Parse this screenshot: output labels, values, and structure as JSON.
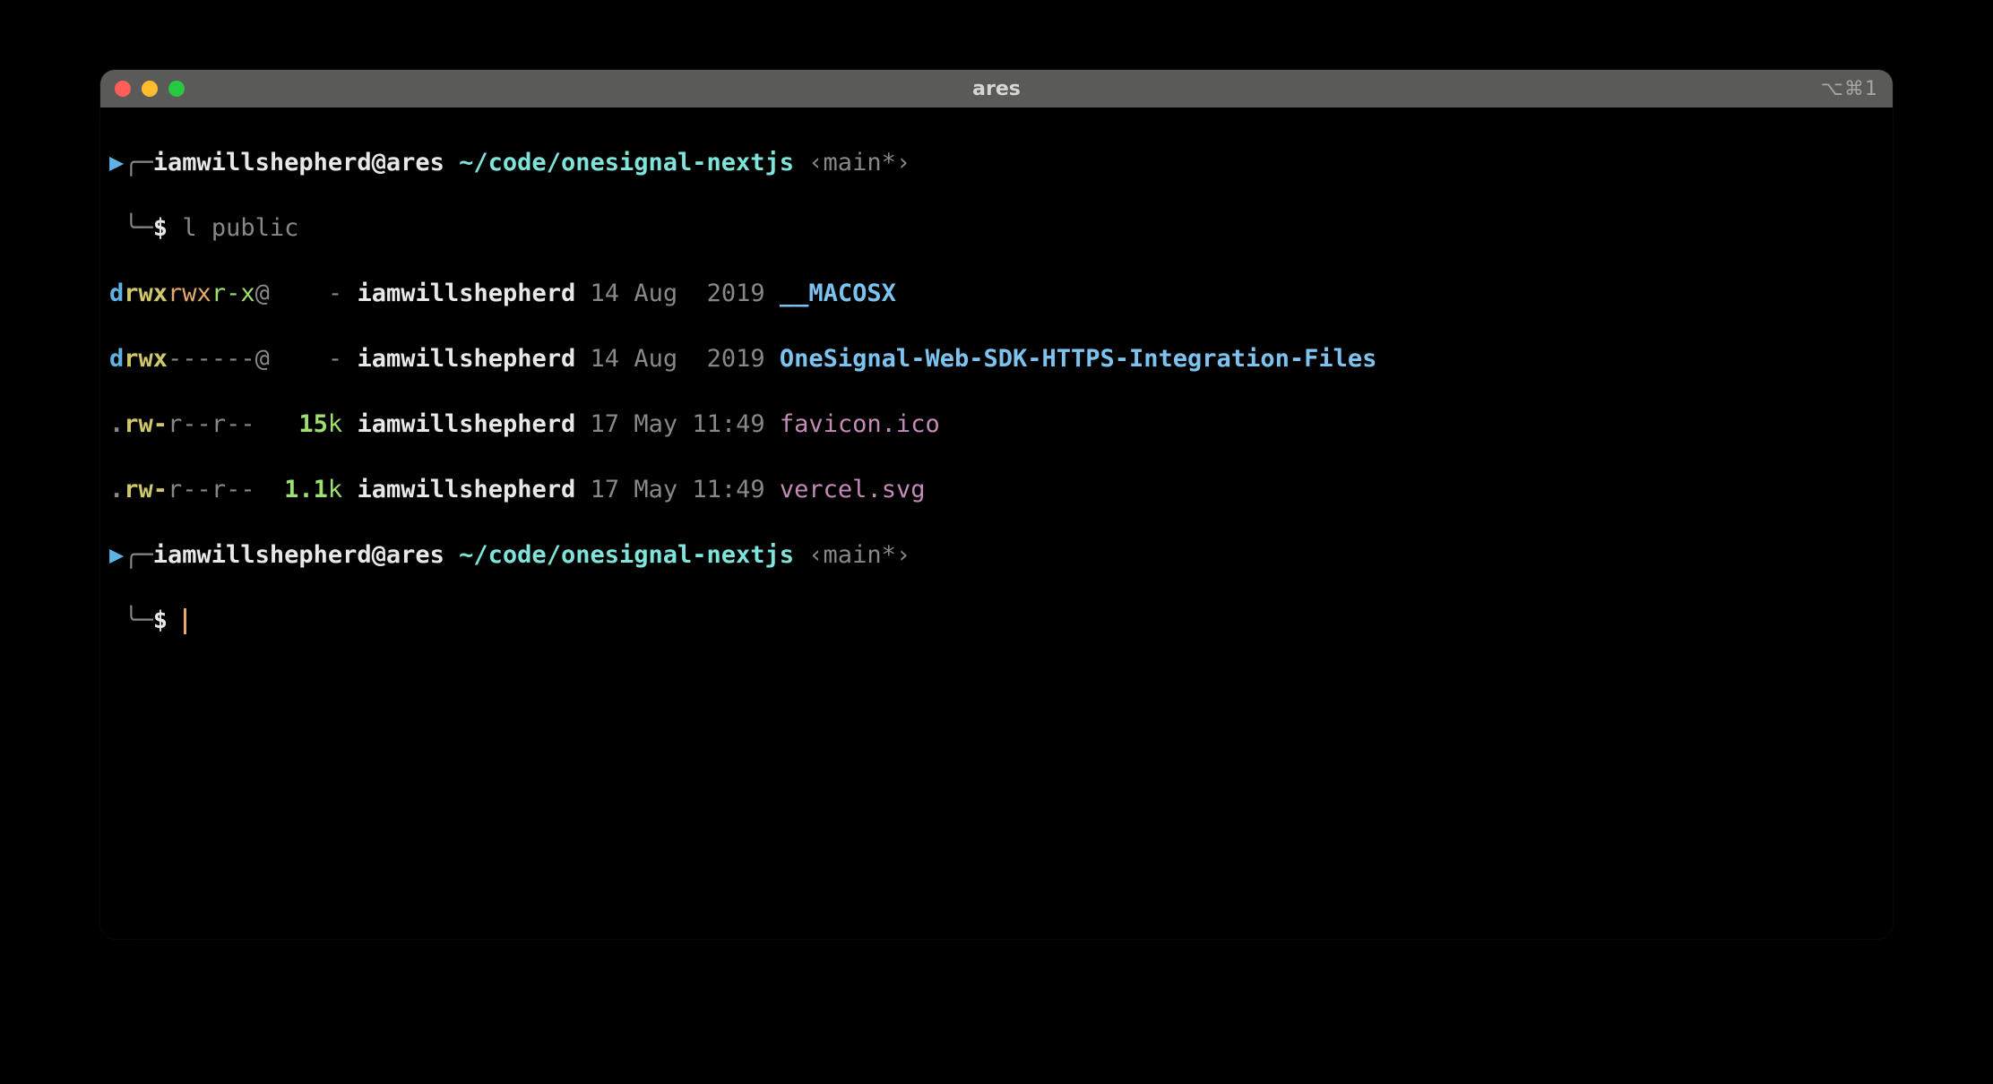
{
  "window": {
    "title": "ares",
    "right_indicator": "⌥⌘1"
  },
  "prompt": {
    "top_corner": "╭─",
    "bottom_corner": "╰─",
    "arrow": "▶",
    "userhost": "iamwillshepherd@ares",
    "path": "~/code/onesignal-nextjs",
    "branch": "‹main*›",
    "symbol": "$"
  },
  "command": "l public",
  "listing": [
    {
      "perms_prefix": "d",
      "perms_u": "rwx",
      "perms_g": "rwx",
      "perms_o": "r-x",
      "perms_suffix": "@",
      "size": "-",
      "owner": "iamwillshepherd",
      "date": "14 Aug  2019",
      "name": "__MACOSX",
      "is_dir": true
    },
    {
      "perms_prefix": "d",
      "perms_u": "rwx",
      "perms_g": "---",
      "perms_o": "---",
      "perms_suffix": "@",
      "size": "-",
      "owner": "iamwillshepherd",
      "date": "14 Aug  2019",
      "name": "OneSignal-Web-SDK-HTTPS-Integration-Files",
      "is_dir": true
    },
    {
      "perms_prefix": ".",
      "perms_u": "rw-",
      "perms_g": "r--",
      "perms_o": "r--",
      "perms_suffix": " ",
      "size_num": "15",
      "size_unit": "k",
      "owner": "iamwillshepherd",
      "date": "17 May 11:49",
      "name": "favicon.ico",
      "is_dir": false
    },
    {
      "perms_prefix": ".",
      "perms_u": "rw-",
      "perms_g": "r--",
      "perms_o": "r--",
      "perms_suffix": " ",
      "size_num": "1.1",
      "size_unit": "k",
      "owner": "iamwillshepherd",
      "date": "17 May 11:49",
      "name": "vercel.svg",
      "is_dir": false
    }
  ]
}
